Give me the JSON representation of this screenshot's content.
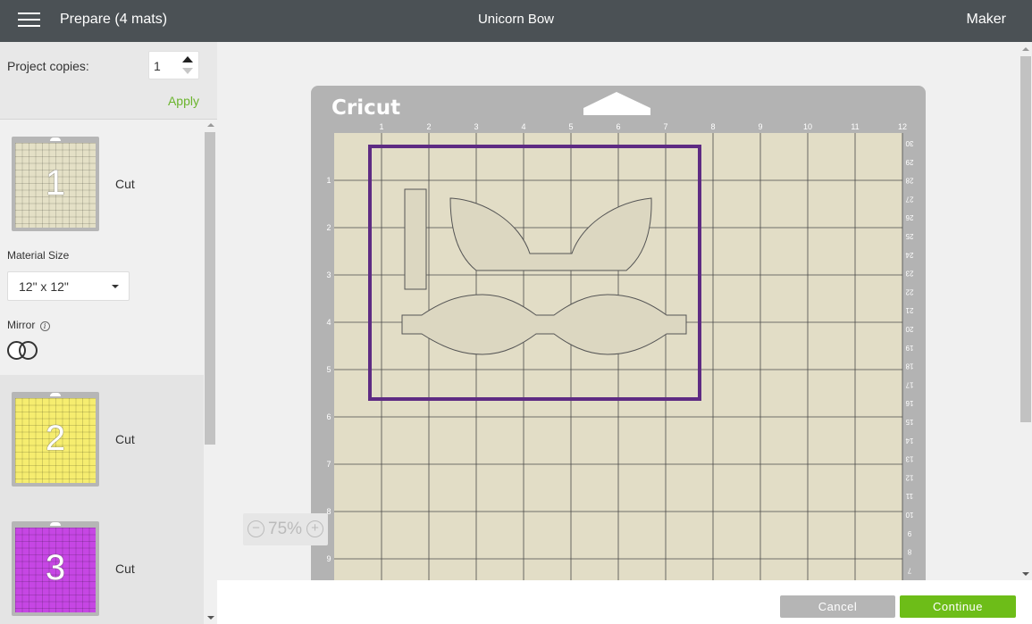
{
  "header": {
    "title": "Prepare (4 mats)",
    "project_name": "Unicorn Bow",
    "machine": "Maker"
  },
  "sidebar": {
    "copies_label": "Project copies:",
    "copies_value": "1",
    "apply_label": "Apply",
    "mats": [
      {
        "number": "1",
        "action": "Cut",
        "color": "#e4e0c6",
        "selected": true
      },
      {
        "number": "2",
        "action": "Cut",
        "color": "#f6ed6f",
        "selected": false
      },
      {
        "number": "3",
        "action": "Cut",
        "color": "#c646e4",
        "selected": false
      }
    ],
    "material_size_label": "Material Size",
    "material_size_value": "12\" x 12\"",
    "mirror_label": "Mirror",
    "mirror_on": false
  },
  "canvas": {
    "brand_logo": "Cricut",
    "top_ruler": [
      "1",
      "2",
      "3",
      "4",
      "5",
      "6",
      "7",
      "8",
      "9",
      "10",
      "11",
      "12"
    ],
    "left_ruler": [
      "1",
      "2",
      "3",
      "4",
      "5",
      "6",
      "7",
      "8",
      "9"
    ],
    "right_ruler": [
      "30",
      "29",
      "28",
      "27",
      "26",
      "25",
      "24",
      "23",
      "22",
      "21",
      "20",
      "19",
      "18",
      "17",
      "16",
      "15",
      "14",
      "13",
      "12",
      "11",
      "10",
      "9",
      "8",
      "7"
    ],
    "mat_color": "#e2ddc6",
    "selection_color": "#5e2b83",
    "zoom": "75%"
  },
  "footer": {
    "cancel_label": "Cancel",
    "continue_label": "Continue"
  },
  "colors": {
    "header_bg": "#4b5155",
    "accent_green": "#6dbd18"
  }
}
